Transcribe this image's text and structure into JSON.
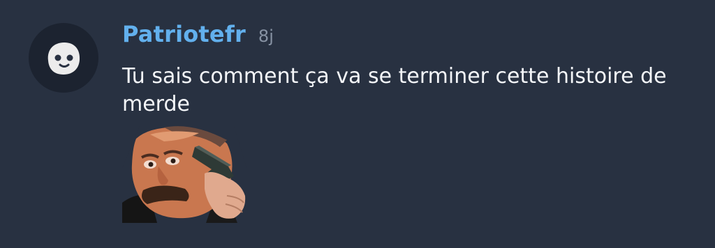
{
  "comment": {
    "author": "Patriotefr",
    "time_ago": "8j",
    "text": "Tu sais comment ça va se terminer cette histoire de merde",
    "avatar_icon": "smiley-face-icon",
    "sticker_icon": "meme-sticker-gun"
  },
  "colors": {
    "background": "#283141",
    "username": "#62b0ed",
    "timestamp": "#8792a3",
    "text": "#f4f6f9"
  }
}
